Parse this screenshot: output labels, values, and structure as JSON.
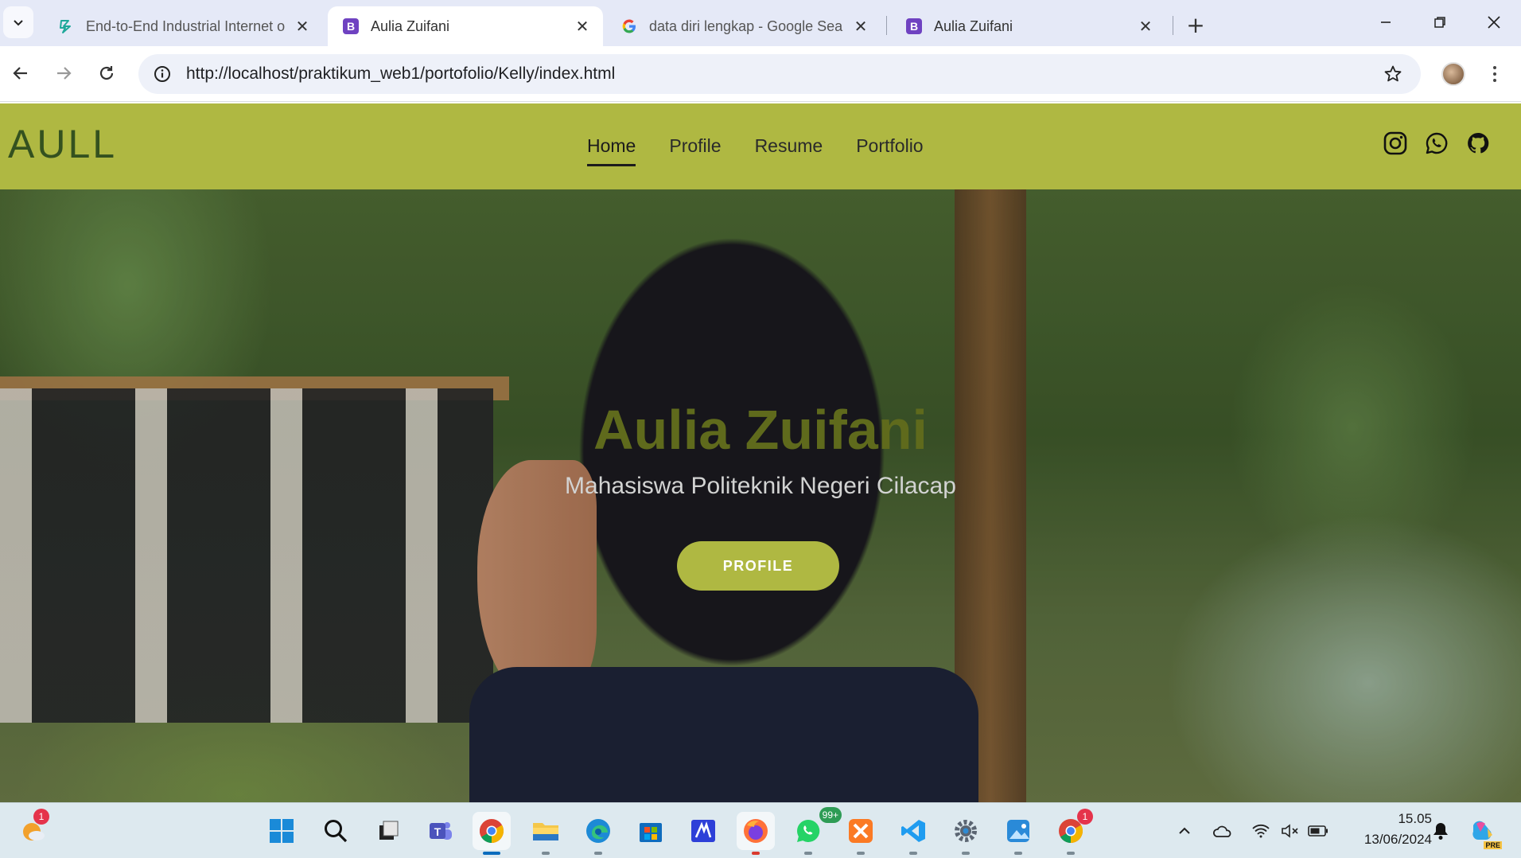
{
  "browser": {
    "tabs": [
      {
        "title": "End-to-End Industrial Internet o",
        "icon": "botpress-icon",
        "active": false
      },
      {
        "title": "Aulia Zuifani",
        "icon": "bootstrap-icon",
        "active": true
      },
      {
        "title": "data diri lengkap - Google Sear",
        "icon": "google-icon",
        "active": false
      },
      {
        "title": "Aulia Zuifani",
        "icon": "bootstrap-icon",
        "active": false
      }
    ],
    "new_tab_label": "+",
    "url": "http://localhost/praktikum_web1/portofolio/Kelly/index.html"
  },
  "site": {
    "brand": "AULL",
    "menu": [
      "Home",
      "Profile",
      "Resume",
      "Portfolio"
    ],
    "active_menu": "Home",
    "socials": [
      "instagram-icon",
      "whatsapp-icon",
      "github-icon"
    ],
    "hero": {
      "title": "Aulia Zuifani",
      "subtitle": "Mahasiswa Politeknik Negeri Cilacap",
      "button": "PROFILE"
    },
    "colors": {
      "accent": "#afb842",
      "brand_text": "#34511f",
      "hero_title": "#5f6a1c"
    }
  },
  "taskbar": {
    "weather_badge": "1",
    "whatsapp_badge": "99+",
    "chrome2_badge": "1",
    "time": "15.05",
    "date": "13/06/2024",
    "copilot_label": "PRE"
  }
}
